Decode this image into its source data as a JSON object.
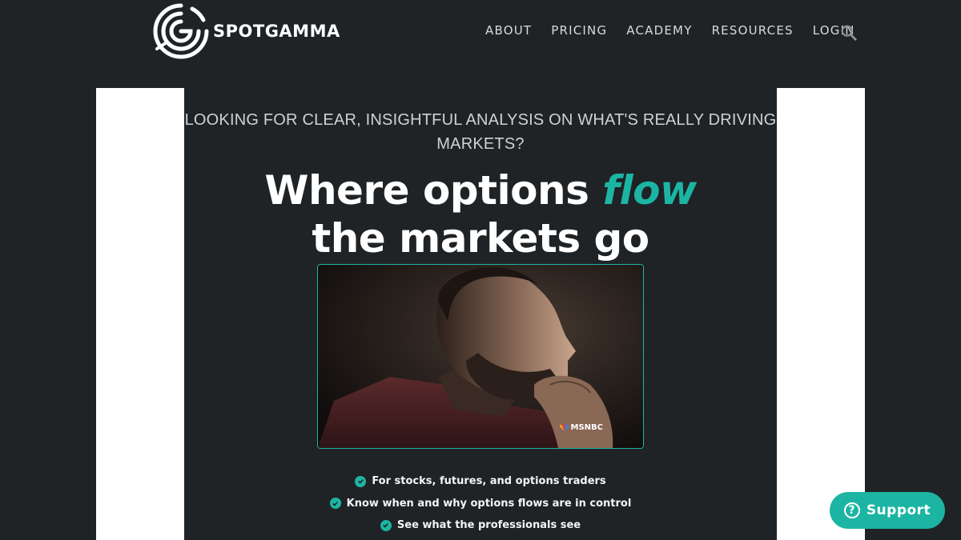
{
  "brand": {
    "name": "SPOTGAMMA"
  },
  "nav": {
    "items": [
      {
        "label": "ABOUT"
      },
      {
        "label": "PRICING"
      },
      {
        "label": "ACADEMY"
      },
      {
        "label": "RESOURCES"
      },
      {
        "label": "LOGIN"
      }
    ],
    "search_icon": "search-icon"
  },
  "hero": {
    "kicker_line1": "LOOKING FOR CLEAR, INSIGHTFUL ANALYSIS ON WHAT'S REALLY DRIVING",
    "kicker_line2": "MARKETS?",
    "headline_pre": "Where options ",
    "headline_accent": "flow",
    "headline_line2": "the markets go",
    "video_badge": "MSNBC"
  },
  "features": [
    {
      "text": "For stocks, futures, and options traders"
    },
    {
      "text": "Know when and why options flows are in control"
    },
    {
      "text": "See what the professionals see"
    }
  ],
  "support": {
    "label": "Support",
    "icon": "help-icon"
  },
  "colors": {
    "background": "#1f2326",
    "accent": "#1cb5a3",
    "panel": "#ffffff"
  }
}
